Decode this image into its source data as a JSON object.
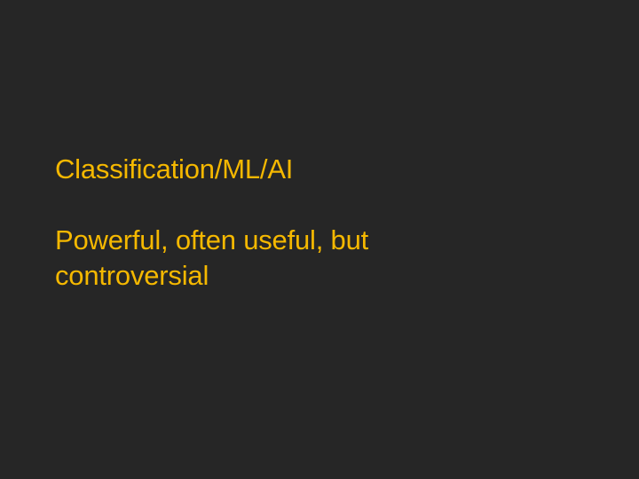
{
  "slide": {
    "background": "#262626",
    "text_color": "#f5b800",
    "title": "Classification/ML/AI",
    "body_line_1": "Powerful, often useful, but",
    "body_line_2": "controversial"
  }
}
